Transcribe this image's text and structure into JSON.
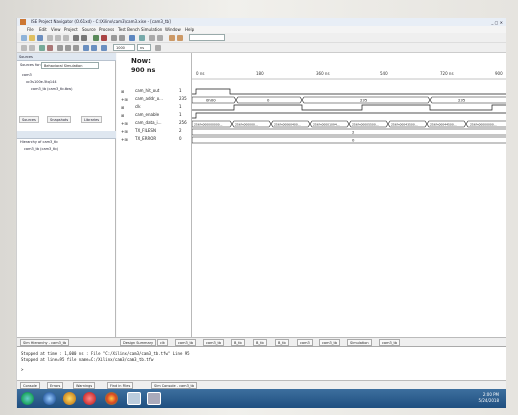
{
  "window": {
    "title": "ISE Project Navigator (O.61xd) - C:\\Xilinx\\cam3\\cam3.xise - [cam3_tb]"
  },
  "menu": [
    "File",
    "Edit",
    "View",
    "Project",
    "Source",
    "Process",
    "Test Bench",
    "Simulation",
    "Window",
    "Help"
  ],
  "toolbar": {
    "zoom_value": "1000",
    "time_unit": "ns"
  },
  "sources": {
    "header": "Sources",
    "sources_for_label": "Sources for:",
    "sources_for_value": "Behavioral Simulation",
    "tree": [
      "cam3",
      "xc3s100e-5tq144",
      "cam3_tb (cam3_tb.tbw)"
    ],
    "tabs": [
      "Sources",
      "Snapshots",
      "Libraries"
    ]
  },
  "hierarchy": {
    "items": [
      "Hierarchy of cam3_tb",
      "cam3_tb (cam3_tb)"
    ]
  },
  "wave": {
    "now_label": "Now:",
    "now_value": "900 ns",
    "time_ticks": [
      "0 ns",
      "180",
      "360 ns",
      "540",
      "720 ns",
      "900"
    ],
    "signals": [
      {
        "name": "cam_hit_out",
        "value": "1"
      },
      {
        "name": "cam_addr_o...",
        "value": "235"
      },
      {
        "name": "clk",
        "value": "1"
      },
      {
        "name": "cam_enable",
        "value": "1"
      },
      {
        "name": "cam_data_i...",
        "value": "256"
      },
      {
        "name": "TX_FILESN",
        "value": "2"
      },
      {
        "name": "TX_ERROR",
        "value": "0"
      }
    ],
    "bus_labels": {
      "addr_a": "0h00",
      "addr_b": "0",
      "addr_c": "235",
      "addr_d": "235",
      "data": [
        "256'h000000000...",
        "256'h000000...",
        "256'h00060400...",
        "256'h00001094...",
        "256'h00005500...",
        "256'h00043500...",
        "256'h00044500...",
        "256'h00000000..."
      ],
      "filesn": "2",
      "error": "0"
    }
  },
  "bottom_tabs": [
    "Sim Hierarchy - cam3_tb",
    "Design Summary",
    "clk",
    "cam3_tb",
    "cam3_tb",
    "B_tb",
    "B_tb",
    "B_tb",
    "cam3",
    "cam3_tb",
    "Simulation",
    "cam3_tb"
  ],
  "console": {
    "lines": [
      "Stopped at time : 1,000 ns : File \"C:/Xilinx/cam3/cam3_tb.tfw\" Line 95",
      "Stopped at line=95 file name=C:/Xilinx/cam3/cam3_tb.tfw",
      ">"
    ],
    "tabs": [
      "Console",
      "Errors",
      "Warnings",
      "Find in Files",
      "Sim Console - cam3_tb"
    ]
  },
  "taskbar": {
    "time": "2:00 PM",
    "date": "5/24/2018"
  },
  "colors": {
    "taskbar": "#1f4f80",
    "wave_line": "#1b1b1b",
    "bus_fill": "#ffffff"
  }
}
